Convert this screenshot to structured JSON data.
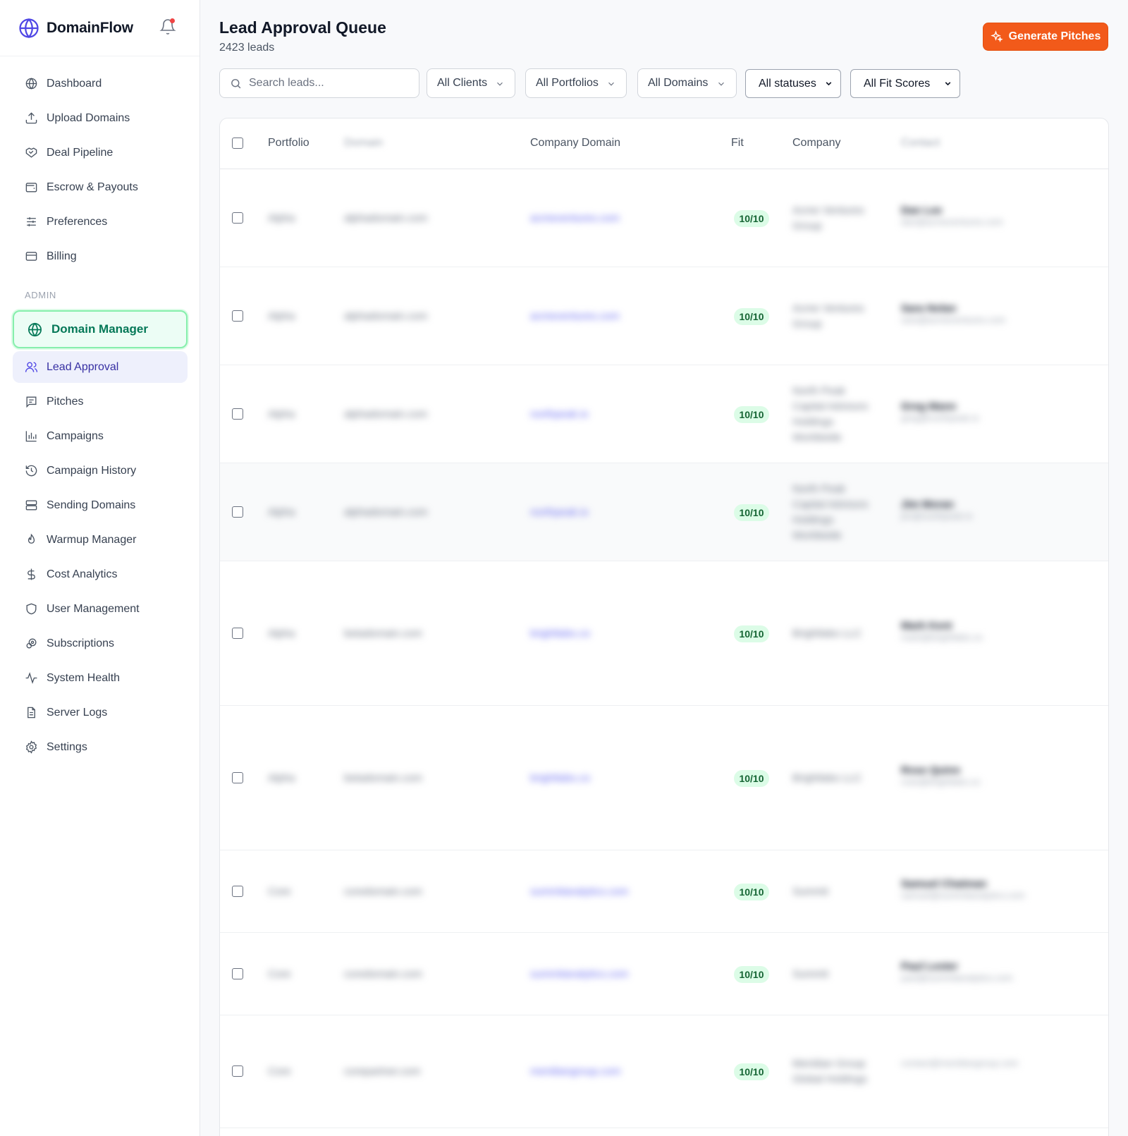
{
  "app": {
    "name": "DomainFlow"
  },
  "sidebar": {
    "items": [
      {
        "label": "Dashboard",
        "icon": "globe-icon"
      },
      {
        "label": "Upload Domains",
        "icon": "upload-icon"
      },
      {
        "label": "Deal Pipeline",
        "icon": "handshake-icon"
      },
      {
        "label": "Escrow & Payouts",
        "icon": "wallet-icon"
      },
      {
        "label": "Preferences",
        "icon": "sliders-icon"
      },
      {
        "label": "Billing",
        "icon": "credit-card-icon"
      }
    ],
    "admin_label": "ADMIN",
    "admin_items": [
      {
        "label": "Domain Manager",
        "icon": "globe-icon"
      },
      {
        "label": "Lead Approval",
        "icon": "users-icon"
      },
      {
        "label": "Pitches",
        "icon": "message-square-icon"
      },
      {
        "label": "Campaigns",
        "icon": "bar-chart-icon"
      },
      {
        "label": "Campaign History",
        "icon": "history-icon"
      },
      {
        "label": "Sending Domains",
        "icon": "server-icon"
      },
      {
        "label": "Warmup Manager",
        "icon": "flame-icon"
      },
      {
        "label": "Cost Analytics",
        "icon": "dollar-icon"
      },
      {
        "label": "User Management",
        "icon": "shield-icon"
      },
      {
        "label": "Subscriptions",
        "icon": "subscription-icon"
      },
      {
        "label": "System Health",
        "icon": "activity-icon"
      },
      {
        "label": "Server Logs",
        "icon": "file-text-icon"
      },
      {
        "label": "Settings",
        "icon": "gear-icon"
      }
    ]
  },
  "header": {
    "title": "Lead Approval Queue",
    "subtitle": "2423 leads",
    "generate_label": "Generate Pitches"
  },
  "filters": {
    "search_placeholder": "Search leads...",
    "clients": "All Clients",
    "portfolios": "All Portfolios",
    "domains": "All Domains",
    "statuses": "All statuses",
    "fit_scores": "All Fit Scores"
  },
  "table": {
    "columns": {
      "portfolio": "Portfolio",
      "domain": "Domain",
      "company_domain": "Company Domain",
      "fit": "Fit",
      "company": "Company",
      "contact": "Contact"
    },
    "rows": [
      {
        "portfolio": "Alpha",
        "domain": "alphadomain.com",
        "company_domain": "acmeventures.com",
        "fit": "10/10",
        "company": [
          "Acme Ventures",
          "Group"
        ],
        "contact_name": "Dan Lee",
        "contact_email": "dan@acmeventures.com"
      },
      {
        "portfolio": "Alpha",
        "domain": "alphadomain.com",
        "company_domain": "acmeventures.com",
        "fit": "10/10",
        "company": [
          "Acme Ventures",
          "Group"
        ],
        "contact_name": "Sara Nolan",
        "contact_email": "sara@acmeventures.com"
      },
      {
        "portfolio": "Alpha",
        "domain": "alphadomain.com",
        "company_domain": "northpeak.io",
        "fit": "10/10",
        "company": [
          "North Peak",
          "Capital Advisors",
          "Holdings",
          "Worldwide"
        ],
        "contact_name": "Greg Mann",
        "contact_email": "greg@northpeak.io"
      },
      {
        "portfolio": "Alpha",
        "domain": "alphadomain.com",
        "company_domain": "northpeak.io",
        "fit": "10/10",
        "company": [
          "North Peak",
          "Capital Advisors",
          "Holdings",
          "Worldwide"
        ],
        "contact_name": "Jim Moran",
        "contact_email": "jim@northpeak.io"
      },
      {
        "portfolio": "Alpha",
        "domain": "betadomain.com",
        "company_domain": "brightlabs.co",
        "fit": "10/10",
        "company": [
          "Brightlabs LLC"
        ],
        "contact_name": "Mark Kent",
        "contact_email": "mark@brightlabs.co"
      },
      {
        "portfolio": "Alpha",
        "domain": "betadomain.com",
        "company_domain": "brightlabs.co",
        "fit": "10/10",
        "company": [
          "Brightlabs LLC"
        ],
        "contact_name": "Rose Quinn",
        "contact_email": "rose@brightlabs.co"
      },
      {
        "portfolio": "Core",
        "domain": "coredomain.com",
        "company_domain": "summitanalytics.com",
        "fit": "10/10",
        "company": [
          "Summit"
        ],
        "contact_name": "Samuel Chatman",
        "contact_email": "samuel@summitanalytics.com"
      },
      {
        "portfolio": "Core",
        "domain": "coredomain.com",
        "company_domain": "summitanalytics.com",
        "fit": "10/10",
        "company": [
          "Summit"
        ],
        "contact_name": "Paul Lester",
        "contact_email": "paul@summitanalytics.com"
      },
      {
        "portfolio": "Core",
        "domain": "corepartner.com",
        "company_domain": "meridiangroup.com",
        "fit": "10/10",
        "company": [
          "Meridian Group",
          "Global Holdings"
        ],
        "contact_name": "",
        "contact_email": "contact@meridiangroup.com"
      }
    ]
  },
  "colors": {
    "accent": "#4f46e5",
    "cta": "#f25a1a",
    "active_green": "#047857",
    "fit_badge": "#dcfce7"
  }
}
